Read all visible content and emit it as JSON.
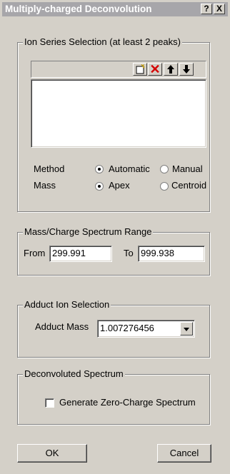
{
  "window": {
    "title": "Multiply-charged Deconvolution",
    "help_label": "?",
    "close_label": "X"
  },
  "ion_series": {
    "legend": "Ion Series Selection (at least 2 peaks)",
    "toolbar": {
      "new_icon": "new-icon",
      "delete_icon": "delete-icon",
      "up_icon": "arrow-up-icon",
      "down_icon": "arrow-down-icon",
      "delete_glyph": "✕",
      "up_glyph": "🡡",
      "down_glyph": "🡣"
    },
    "method_label": "Method",
    "method_options": [
      "Automatic",
      "Manual"
    ],
    "method_selected": "Automatic",
    "mass_label": "Mass",
    "mass_options": [
      "Apex",
      "Centroid"
    ],
    "mass_selected": "Apex"
  },
  "range": {
    "legend": "Mass/Charge Spectrum Range",
    "from_label": "From",
    "from_value": "299.991",
    "to_label": "To",
    "to_value": "999.938"
  },
  "adduct": {
    "legend": "Adduct Ion Selection",
    "mass_label": "Adduct Mass",
    "mass_value": "1.007276456"
  },
  "deconvoluted": {
    "legend": "Deconvoluted Spectrum",
    "checkbox_label": "Generate Zero-Charge Spectrum",
    "checked": false
  },
  "buttons": {
    "ok": "OK",
    "cancel": "Cancel"
  },
  "colors": {
    "face": "#d4d0c8",
    "titlebar_inactive": "#a7a6aa",
    "delete_red": "#d40000"
  }
}
